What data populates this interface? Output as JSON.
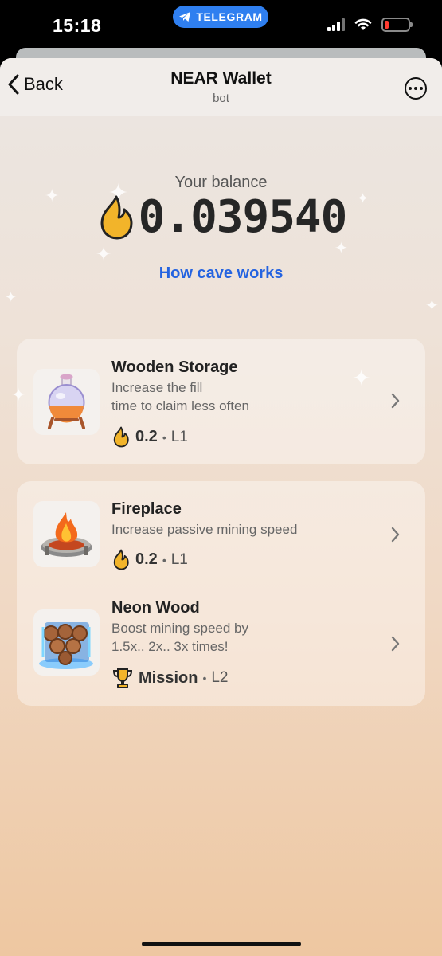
{
  "status_bar": {
    "time": "15:18",
    "pill_label": "TELEGRAM",
    "icons": [
      "cellular-signal-icon",
      "wifi-icon",
      "battery-low-icon"
    ]
  },
  "header": {
    "back_label": "Back",
    "title": "NEAR Wallet",
    "subtitle": "bot"
  },
  "balance": {
    "label": "Your balance",
    "value": "0.039540"
  },
  "how_link": "How cave works",
  "colors": {
    "accent_link": "#2463e0",
    "telegram_blue": "#2f7ff0",
    "flame": "#f2b42a"
  },
  "cards": [
    {
      "items": [
        {
          "title": "Wooden Storage",
          "description_lines": [
            "Increase the fill",
            "time to claim less often"
          ],
          "meta_icon": "flame-icon",
          "meta_value": "0.2",
          "level": "L1"
        }
      ]
    },
    {
      "items": [
        {
          "title": "Fireplace",
          "description_lines": [
            "Increase passive mining speed"
          ],
          "meta_icon": "flame-icon",
          "meta_value": "0.2",
          "level": "L1"
        },
        {
          "title": "Neon Wood",
          "description_lines": [
            "Boost mining speed by",
            "1.5x.. 2x.. 3x times!"
          ],
          "meta_icon": "trophy-icon",
          "meta_value": "Mission",
          "level": "L2"
        }
      ]
    }
  ]
}
